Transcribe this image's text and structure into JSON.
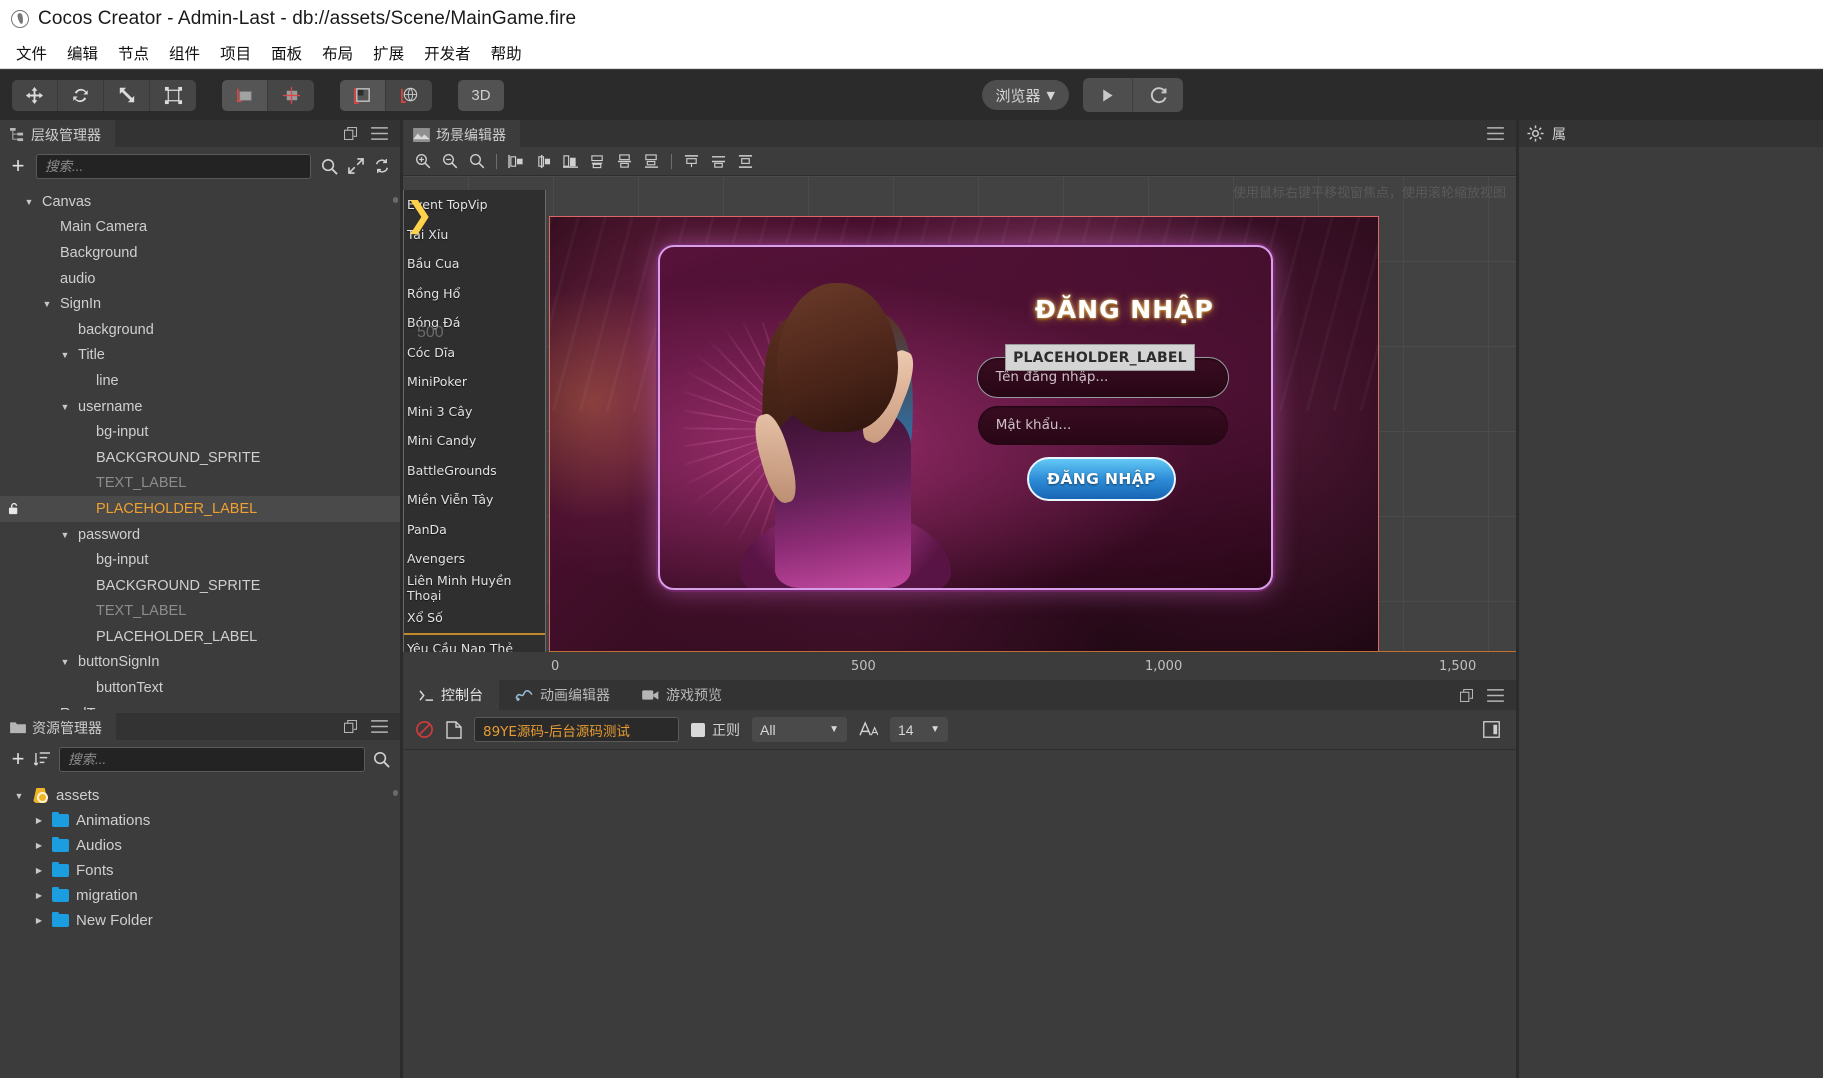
{
  "window": {
    "title": "Cocos Creator - Admin-Last - db://assets/Scene/MainGame.fire",
    "logo_icon": "cocos-logo-icon"
  },
  "menubar": {
    "items": [
      {
        "label": "文件"
      },
      {
        "label": "编辑"
      },
      {
        "label": "节点"
      },
      {
        "label": "组件"
      },
      {
        "label": "项目"
      },
      {
        "label": "面板"
      },
      {
        "label": "布局"
      },
      {
        "label": "扩展"
      },
      {
        "label": "开发者"
      },
      {
        "label": "帮助"
      }
    ]
  },
  "toolbar": {
    "transform_tools": [
      {
        "name": "move-tool",
        "icon": "move-icon"
      },
      {
        "name": "rotate-tool",
        "icon": "rotate-icon"
      },
      {
        "name": "scale-tool",
        "icon": "scale-icon"
      },
      {
        "name": "rect-transform-tool",
        "icon": "rect-transform-icon"
      }
    ],
    "pivot_tools": [
      {
        "name": "pivot-center-tool",
        "icon": "pivot-center-icon"
      },
      {
        "name": "pivot-pivot-tool",
        "icon": "pivot-anchor-icon"
      }
    ],
    "coord_tools": [
      {
        "name": "local-coord-tool",
        "icon": "local-coord-icon"
      },
      {
        "name": "global-coord-tool",
        "icon": "global-coord-icon"
      }
    ],
    "mode_3d_label": "3D",
    "preview_target": "浏览器",
    "preview_caret": "▼",
    "play_label": "play-icon",
    "refresh_label": "refresh-icon"
  },
  "hierarchy": {
    "tab_label": "层级管理器",
    "tab_icon": "hierarchy-icon",
    "add_label": "+",
    "search_placeholder": "搜索...",
    "search_value": "",
    "icons": {
      "search": "search-icon",
      "expand": "expand-icon",
      "refresh": "refresh-icon",
      "popout": "popout-icon",
      "menu": "hamburger-icon"
    },
    "nodes": [
      {
        "label": "Canvas",
        "depth": 0,
        "twisty": "open",
        "state": "normal"
      },
      {
        "label": "Main Camera",
        "depth": 1,
        "twisty": "none",
        "state": "normal"
      },
      {
        "label": "Background",
        "depth": 1,
        "twisty": "none",
        "state": "normal"
      },
      {
        "label": "audio",
        "depth": 1,
        "twisty": "none",
        "state": "normal"
      },
      {
        "label": "SignIn",
        "depth": 1,
        "twisty": "open",
        "state": "normal"
      },
      {
        "label": "background",
        "depth": 2,
        "twisty": "none",
        "state": "normal"
      },
      {
        "label": "Title",
        "depth": 2,
        "twisty": "open",
        "state": "normal"
      },
      {
        "label": "line",
        "depth": 3,
        "twisty": "none",
        "state": "normal"
      },
      {
        "label": "username",
        "depth": 2,
        "twisty": "open",
        "state": "normal"
      },
      {
        "label": "bg-input",
        "depth": 3,
        "twisty": "none",
        "state": "normal"
      },
      {
        "label": "BACKGROUND_SPRITE",
        "depth": 3,
        "twisty": "none",
        "state": "normal"
      },
      {
        "label": "TEXT_LABEL",
        "depth": 3,
        "twisty": "none",
        "state": "dim"
      },
      {
        "label": "PLACEHOLDER_LABEL",
        "depth": 3,
        "twisty": "none",
        "state": "selected"
      },
      {
        "label": "password",
        "depth": 2,
        "twisty": "open",
        "state": "normal"
      },
      {
        "label": "bg-input",
        "depth": 3,
        "twisty": "none",
        "state": "normal"
      },
      {
        "label": "BACKGROUND_SPRITE",
        "depth": 3,
        "twisty": "none",
        "state": "normal"
      },
      {
        "label": "TEXT_LABEL",
        "depth": 3,
        "twisty": "none",
        "state": "dim"
      },
      {
        "label": "PLACEHOLDER_LABEL",
        "depth": 3,
        "twisty": "none",
        "state": "normal"
      },
      {
        "label": "buttonSignIn",
        "depth": 2,
        "twisty": "open",
        "state": "normal"
      },
      {
        "label": "buttonText",
        "depth": 3,
        "twisty": "none",
        "state": "normal"
      },
      {
        "label": "RedT",
        "depth": 1,
        "twisty": "open",
        "state": "normal"
      }
    ]
  },
  "assets": {
    "tab_label": "资源管理器",
    "tab_icon": "folder-icon",
    "add_label": "+",
    "search_placeholder": "搜索...",
    "search_value": "",
    "icons": {
      "sort": "sort-icon",
      "search": "search-icon",
      "popout": "popout-icon",
      "menu": "hamburger-icon"
    },
    "nodes": [
      {
        "label": "assets",
        "depth": 0,
        "twisty": "open",
        "icon": "assets-root-icon"
      },
      {
        "label": "Animations",
        "depth": 1,
        "twisty": "closed",
        "icon": "folder-icon"
      },
      {
        "label": "Audios",
        "depth": 1,
        "twisty": "closed",
        "icon": "folder-icon"
      },
      {
        "label": "Fonts",
        "depth": 1,
        "twisty": "closed",
        "icon": "folder-icon"
      },
      {
        "label": "migration",
        "depth": 1,
        "twisty": "closed",
        "icon": "folder-icon"
      },
      {
        "label": "New Folder",
        "depth": 1,
        "twisty": "closed",
        "icon": "folder-icon"
      }
    ]
  },
  "scene": {
    "tab_label": "场景编辑器",
    "tab_icon": "scene-icon",
    "hint_text": "使用鼠标右键平移视窗焦点，使用滚轮缩放视图",
    "toolbar_tools": [
      {
        "name": "zoom-in-tool",
        "icon": "zoom-in-icon"
      },
      {
        "name": "zoom-out-tool",
        "icon": "zoom-out-icon"
      },
      {
        "name": "zoom-reset-tool",
        "icon": "zoom-reset-icon"
      },
      {
        "name": "align-left-tool",
        "icon": "align-left-icon"
      },
      {
        "name": "align-center-h-tool",
        "icon": "align-center-h-icon"
      },
      {
        "name": "align-right-tool",
        "icon": "align-right-icon"
      },
      {
        "name": "align-top-tool",
        "icon": "align-top-icon"
      },
      {
        "name": "align-middle-v-tool",
        "icon": "align-middle-v-icon"
      },
      {
        "name": "align-bottom-tool",
        "icon": "align-bottom-icon"
      },
      {
        "name": "distribute-h-tool",
        "icon": "distribute-h-icon"
      },
      {
        "name": "distribute-v-tool",
        "icon": "distribute-v-icon"
      },
      {
        "name": "distribute-gap-tool",
        "icon": "distribute-gap-icon"
      }
    ],
    "ruler_ticks": [
      "0",
      "500",
      "1,000",
      "1,500"
    ],
    "overlay_500": "500",
    "arrow_glyph": "❯",
    "game_list": [
      "Event TopVip",
      "Tài Xỉu",
      "Bầu Cua",
      "Rồng Hổ",
      "Bóng Đá",
      "Cóc Dĩa",
      "MiniPoker",
      "Mini 3 Cây",
      "Mini Candy",
      "BattleGrounds",
      "Miền Viễn Tây",
      "PanDa",
      "Avengers",
      "Liên Minh Huyền Thoại",
      "Xổ Số",
      "Yêu Cầu Nạp Thẻ"
    ],
    "game_dialog": {
      "title": "ĐĂNG NHẬP",
      "placeholder_overlay": "PLACEHOLDER_LABEL",
      "username_placeholder": "Tên đăng nhập...",
      "password_placeholder": "Mật khẩu...",
      "submit_label": "ĐĂNG NHẬP"
    }
  },
  "console": {
    "tabs": [
      {
        "label": "控制台",
        "icon": "console-icon",
        "active": true
      },
      {
        "label": "动画编辑器",
        "icon": "animation-icon",
        "active": false
      },
      {
        "label": "游戏预览",
        "icon": "game-preview-icon",
        "active": false
      }
    ],
    "clear_icon": "clear-circle-icon",
    "file_icon": "file-icon",
    "filter_value": "89YE源码-后台源码测试",
    "regex_label": "正则",
    "regex_checked": true,
    "level_value": "All",
    "level_caret": "▼",
    "fontsize_icon": "font-size-icon",
    "fontsize_value": "14",
    "fontsize_caret": "▼",
    "collapse_icon": "collapse-icon",
    "popout_icon": "popout-icon",
    "menu_icon": "hamburger-icon",
    "messages": []
  },
  "inspector": {
    "gear_icon": "gear-icon",
    "tab_label": "属"
  },
  "colors": {
    "accent_orange": "#f0a030",
    "console_filter_text": "#e89c32",
    "panel_bg": "#3c3c3c",
    "toolbar_bg": "#2b2b2b",
    "titlebar_bg": "#ffffff",
    "folder_blue": "#1c9de0",
    "assets_gold": "#f0b429"
  }
}
